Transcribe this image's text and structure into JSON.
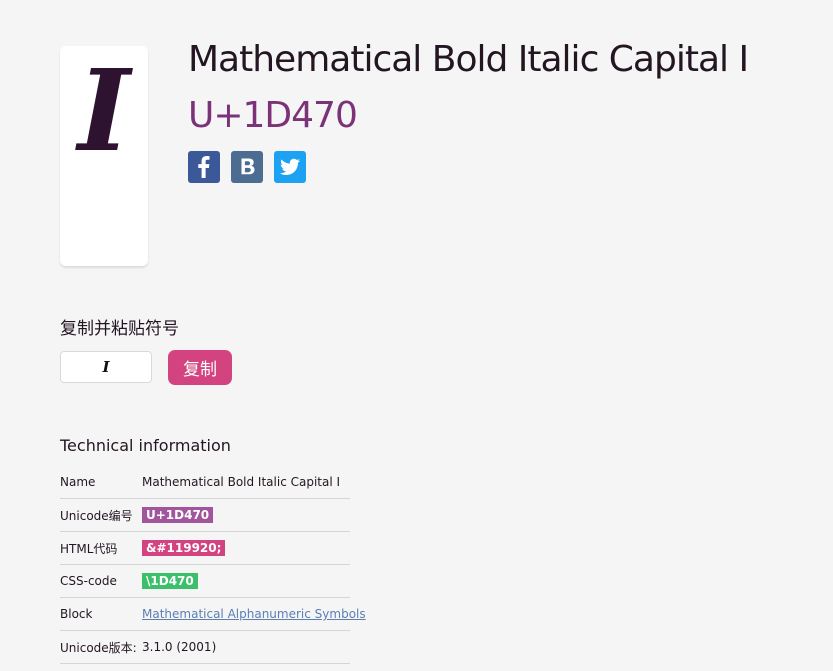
{
  "glyph": {
    "char": "𝑰"
  },
  "header": {
    "title": "Mathematical Bold Italic Capital I",
    "codepoint": "U+1D470"
  },
  "social": [
    {
      "name": "facebook-icon",
      "color": "#3b5998"
    },
    {
      "name": "vk-icon",
      "color": "#4c6c91"
    },
    {
      "name": "twitter-icon",
      "color": "#1da1f2"
    }
  ],
  "copy": {
    "label": "复制并粘贴符号",
    "value": "𝑰",
    "button_label": "复制"
  },
  "tech": {
    "heading": "Technical information",
    "rows": [
      {
        "key": "Name",
        "value": "Mathematical Bold Italic Capital I"
      },
      {
        "key": "Unicode编号",
        "value": "U+1D470"
      },
      {
        "key": "HTML代码",
        "value": "&#119920;"
      },
      {
        "key": "CSS-code",
        "value": "\\1D470"
      },
      {
        "key": "Block",
        "value": "Mathematical Alphanumeric Symbols"
      },
      {
        "key": "Unicode版本:",
        "value": "3.1.0 (2001)"
      }
    ]
  },
  "colors": {
    "accent": "#7b3278",
    "copy_button": "#d2437f",
    "unicode_pill": "#a0559c",
    "html_pill": "#d2437f",
    "css_pill": "#3cbf6b",
    "link": "#5b7fb3"
  }
}
